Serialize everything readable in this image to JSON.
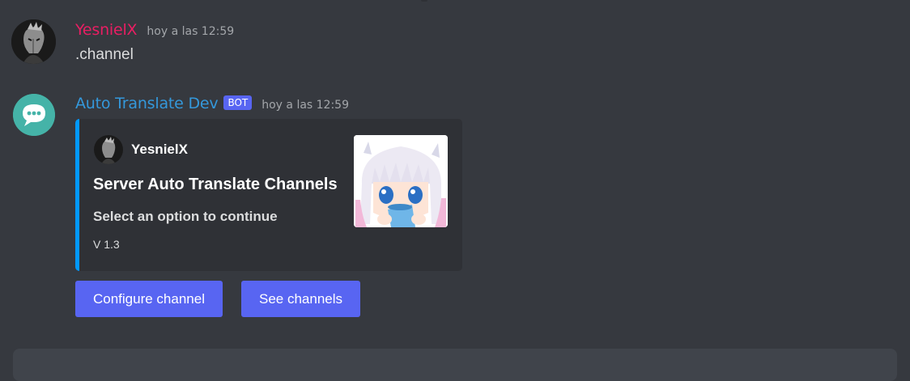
{
  "colors": {
    "background": "#36393f",
    "embed_bg": "#2f3136",
    "embed_accent": "#0099ff",
    "user1_name": "#e91e63",
    "bot_name": "#3498db",
    "button": "#5865f2",
    "bot_tag": "#5865f2"
  },
  "messages": [
    {
      "author": "YesnielX",
      "timestamp": "hoy a las 12:59",
      "content": ".channel",
      "avatar_icon": "user-avatar-icon"
    },
    {
      "author": "Auto Translate Dev",
      "tag": "BOT",
      "timestamp": "hoy a las 12:59",
      "avatar_icon": "speech-bubble-icon",
      "embed": {
        "author_name": "YesnielX",
        "title": "Server Auto Translate Channels",
        "description": "Select an option to continue",
        "footer": "V 1.3",
        "thumbnail_icon": "anime-character-thumbnail"
      },
      "buttons": [
        {
          "label": "Configure channel"
        },
        {
          "label": "See channels"
        }
      ]
    }
  ]
}
